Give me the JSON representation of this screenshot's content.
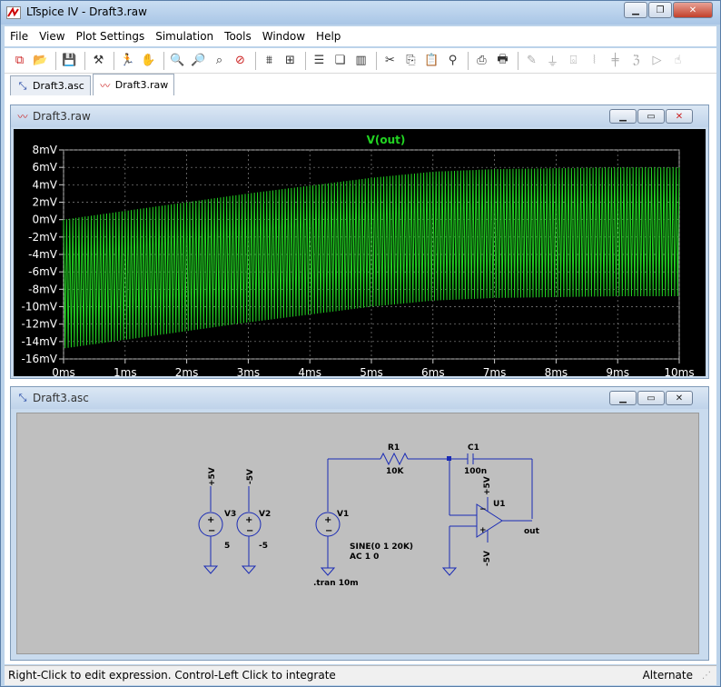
{
  "window": {
    "title": "LTspice IV - Draft3.raw"
  },
  "menu": [
    "File",
    "View",
    "Plot Settings",
    "Simulation",
    "Tools",
    "Window",
    "Help"
  ],
  "toolbar_icons": [
    "new-schematic-icon",
    "open-icon",
    "save-icon",
    "control-panel-icon",
    "run-icon",
    "halt-icon",
    "zoom-in-icon",
    "zoom-out-icon",
    "zoom-fit-icon",
    "zoom-cancel-icon",
    "autorange-icon",
    "grid-icon",
    "tile-horizontal-icon",
    "cascade-icon",
    "tile-vertical-icon",
    "cut-icon",
    "copy-icon",
    "paste-icon",
    "find-icon",
    "print-preview-icon",
    "print-icon",
    "draw-wire-icon",
    "ground-icon",
    "label-net-icon",
    "resistor-icon",
    "capacitor-icon",
    "inductor-icon",
    "diode-icon",
    "component-icon"
  ],
  "tabs": [
    {
      "label": "Draft3.asc",
      "icon": "schematic-icon",
      "active": false
    },
    {
      "label": "Draft3.raw",
      "icon": "waveform-icon",
      "active": true
    }
  ],
  "plot_window": {
    "title": "Draft3.raw",
    "trace_name": "V(out)",
    "trace_color": "#22d422"
  },
  "chart_data": {
    "type": "line",
    "series": [
      {
        "name": "V(out)",
        "color": "#22d422"
      }
    ],
    "x_ticks": [
      "0ms",
      "1ms",
      "2ms",
      "3ms",
      "4ms",
      "5ms",
      "6ms",
      "7ms",
      "8ms",
      "9ms",
      "10ms"
    ],
    "y_ticks": [
      "8mV",
      "6mV",
      "4mV",
      "2mV",
      "0mV",
      "-2mV",
      "-4mV",
      "-6mV",
      "-8mV",
      "-10mV",
      "-12mV",
      "-14mV",
      "-16mV"
    ],
    "xlim_ms": [
      0,
      10
    ],
    "ylim_mV": [
      -16,
      8
    ],
    "envelope_ms": [
      0,
      1,
      2,
      3,
      4,
      5,
      6,
      7,
      8,
      9,
      10
    ],
    "envelope_max_mV": [
      0.0,
      1.0,
      2.0,
      3.0,
      3.9,
      4.8,
      5.5,
      5.8,
      5.9,
      6.0,
      6.0
    ],
    "envelope_min_mV": [
      -14.8,
      -13.8,
      -12.8,
      -11.8,
      -10.9,
      -10.0,
      -9.3,
      -9.0,
      -8.9,
      -8.8,
      -8.8
    ],
    "frequency_kHz": 20,
    "grid": true
  },
  "schematic_window": {
    "title": "Draft3.asc",
    "labels": {
      "v3_name": "V3",
      "v3_value": "5",
      "v3_net": "+5V",
      "v2_name": "V2",
      "v2_value": "-5",
      "v2_net": "-5V",
      "v1_name": "V1",
      "v1_value1": "SINE(0 1 20K)",
      "v1_value2": "AC 1 0",
      "r1_name": "R1",
      "r1_value": "10K",
      "c1_name": "C1",
      "c1_value": "100n",
      "u1_name": "U1",
      "u1_pos": "+5V",
      "u1_neg": "-5V",
      "out_net": "out",
      "tran": ".tran 10m"
    }
  },
  "status": {
    "left": "Right-Click to edit expression. Control-Left Click to integrate",
    "right": "Alternate"
  }
}
